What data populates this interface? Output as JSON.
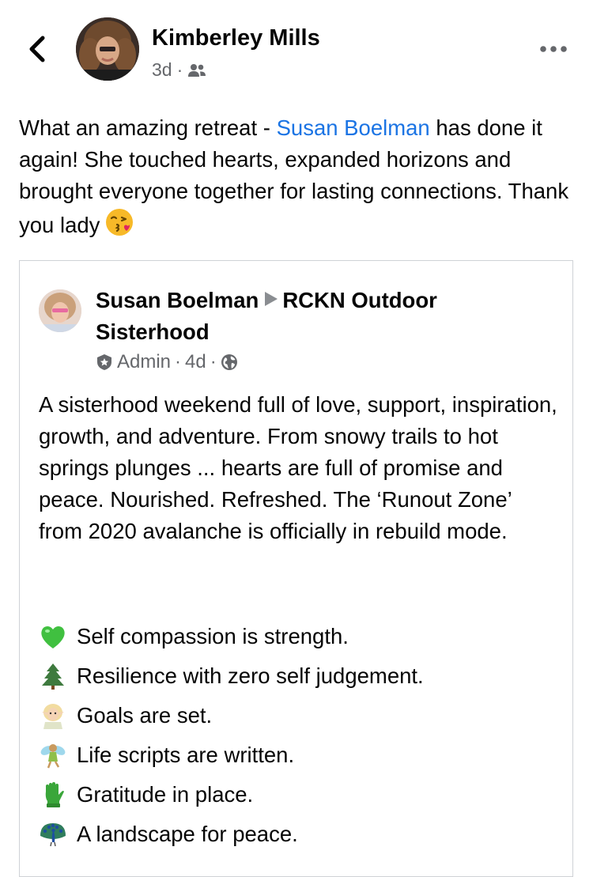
{
  "header": {
    "author_name": "Kimberley Mills",
    "time": "3d",
    "separator": "·",
    "audience_icon": "group-icon",
    "back_icon": "chevron-left-icon",
    "more_icon": "more-horizontal-icon"
  },
  "post": {
    "text_before_mention": "What an amazing retreat - ",
    "mention": "Susan Boelman",
    "text_after_mention": " has done it again! She touched hearts,  expanded horizons and brought everyone together for lasting connections. Thank you lady",
    "emoji": "face-blowing-kiss-emoji"
  },
  "shared_post": {
    "author": "Susan Boelman",
    "group": "RCKN Outdoor Sisterhood",
    "role": "Admin",
    "time": "4d",
    "separator": "·",
    "privacy_icon": "globe-icon",
    "body": "A sisterhood weekend full of love, support, inspiration, growth, and adventure. From snowy trails to hot springs plunges ... hearts are full of promise and peace. Nourished. Refreshed. The ‘Runout Zone’ from 2020 avalanche is officially in rebuild mode.",
    "list": [
      {
        "emoji": "green-heart-emoji",
        "text": "Self compassion is strength."
      },
      {
        "emoji": "evergreen-tree-emoji",
        "text": "Resilience with zero self judgement."
      },
      {
        "emoji": "elf-emoji",
        "text": "Goals are set."
      },
      {
        "emoji": "fairy-emoji",
        "text": "Life scripts are written."
      },
      {
        "emoji": "glove-emoji",
        "text": "Gratitude in place."
      },
      {
        "emoji": "peacock-emoji",
        "text": "A landscape for peace."
      }
    ]
  },
  "colors": {
    "text": "#050505",
    "secondary": "#65676b",
    "link": "#1b74e4",
    "border": "#cfd2d6"
  }
}
